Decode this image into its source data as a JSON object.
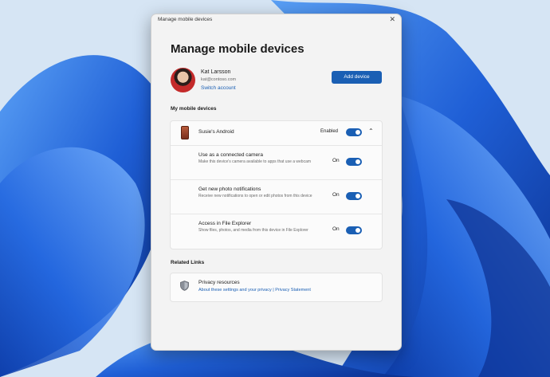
{
  "dialog": {
    "window_title": "Manage mobile devices",
    "close_glyph": "✕",
    "heading": "Manage mobile devices"
  },
  "account": {
    "name": "Kat Larsson",
    "email": "kat@contoso.com",
    "switch_label": "Switch account",
    "add_button": "Add device"
  },
  "devices": {
    "section_label": "My mobile devices",
    "device_name": "Susie's Android",
    "enabled_label": "Enabled",
    "enabled": true,
    "expanded": true,
    "settings": [
      {
        "title": "Use as a connected camera",
        "description": "Make this device's camera available to apps that use a webcam",
        "state_label": "On",
        "on": true
      },
      {
        "title": "Get new photo notifications",
        "description": "Receive new notifications to open or edit photos from this device",
        "state_label": "On",
        "on": true
      },
      {
        "title": "Access in File Explorer",
        "description": "Show files, photos, and media from this device in File Explorer",
        "state_label": "On",
        "on": true
      }
    ]
  },
  "related": {
    "section_label": "Related Links",
    "privacy_title": "Privacy resources",
    "privacy_link1": "About these settings and your privacy",
    "separator": " | ",
    "privacy_link2": "Privacy Statement"
  },
  "colors": {
    "accent": "#1a5fb4",
    "window_bg": "#f3f3f3",
    "card_bg": "#fbfbfb"
  },
  "icons": [
    "close-icon",
    "avatar",
    "phone-icon",
    "chevron-up-icon",
    "shield-icon"
  ]
}
